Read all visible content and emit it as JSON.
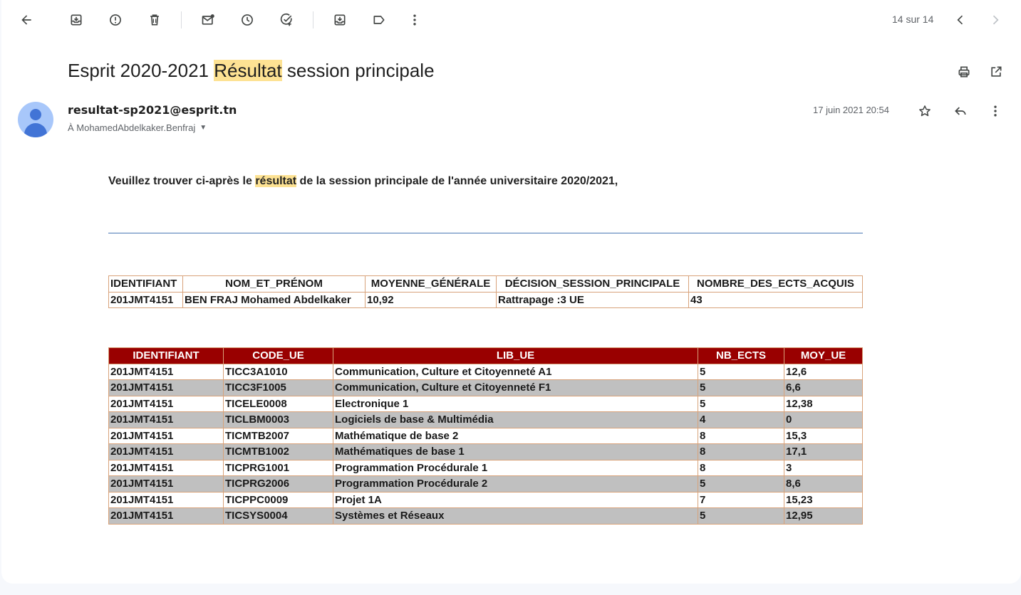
{
  "toolbar": {
    "pager_text": "14 sur 14"
  },
  "email": {
    "subject_before": "Esprit 2020-2021 ",
    "subject_highlight": "Résultat",
    "subject_after": " session principale",
    "sender": "resultat-sp2021@esprit.tn",
    "recipient": "À MohamedAbdelkaker.Benfraj",
    "date": "17 juin 2021 20:54",
    "intro_before": "Veuillez trouver ci-après le ",
    "intro_highlight": "résultat",
    "intro_after": " de la session principale de l'année universitaire 2020/2021,"
  },
  "summary_table": {
    "headers": [
      "IDENTIFIANT",
      "NOM_ET_PRÉNOM",
      "MOYENNE_GÉNÉRALE",
      "DÉCISION_SESSION_PRINCIPALE",
      "NOMBRE_DES_ECTS_ACQUIS"
    ],
    "row": [
      "201JMT4151",
      "BEN FRAJ Mohamed Abdelkaker",
      "10,92",
      "Rattrapage :3 UE",
      "43"
    ]
  },
  "grades_table": {
    "headers": [
      "IDENTIFIANT",
      "CODE_UE",
      "LIB_UE",
      "NB_ECTS",
      "MOY_UE"
    ],
    "rows": [
      [
        "201JMT4151",
        "TICC3A1010",
        "Communication, Culture et Citoyenneté A1",
        "5",
        "12,6"
      ],
      [
        "201JMT4151",
        "TICC3F1005",
        "Communication, Culture et Citoyenneté F1",
        "5",
        "6,6"
      ],
      [
        "201JMT4151",
        "TICELE0008",
        "Electronique 1",
        "5",
        "12,38"
      ],
      [
        "201JMT4151",
        "TICLBM0003",
        "Logiciels de base & Multimédia",
        "4",
        "0"
      ],
      [
        "201JMT4151",
        "TICMTB2007",
        "Mathématique de base 2",
        "8",
        "15,3"
      ],
      [
        "201JMT4151",
        "TICMTB1002",
        "Mathématiques de base 1",
        "8",
        "17,1"
      ],
      [
        "201JMT4151",
        "TICPRG1001",
        "Programmation Procédurale 1",
        "8",
        "3"
      ],
      [
        "201JMT4151",
        "TICPRG2006",
        "Programmation Procédurale 2",
        "5",
        "8,6"
      ],
      [
        "201JMT4151",
        "TICPPC0009",
        "Projet 1A",
        "7",
        "15,23"
      ],
      [
        "201JMT4151",
        "TICSYS0004",
        "Systèmes et Réseaux",
        "5",
        "12,95"
      ]
    ]
  },
  "colors": {
    "highlight": "#fde293",
    "grades_header_bg": "#990000",
    "stripe": "#c0c0c0",
    "border": "#d8a27a"
  }
}
